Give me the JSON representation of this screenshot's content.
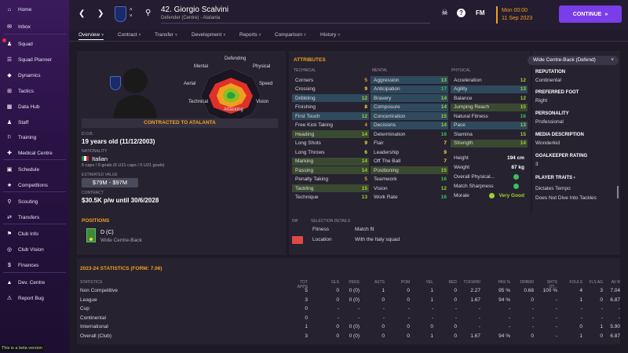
{
  "sidebar": {
    "items": [
      "Home",
      "Inbox",
      "Squad",
      "Squad Planner",
      "Dynamics",
      "Tactics",
      "Data Hub",
      "Staff",
      "Training",
      "Medical Centre",
      "Schedule",
      "Competitions",
      "Scouting",
      "Transfers",
      "Club Info",
      "Club Vision",
      "Finances",
      "Dev. Centre",
      "Report Bug"
    ],
    "beta": "This is a beta version"
  },
  "header": {
    "player_name": "42. Giorgio Scalvini",
    "player_sub": "Defender (Centre) - Atalanta",
    "date_line1": "Mon 00:00",
    "date_line2": "11 Sep 2023",
    "continue": "CONTINUE",
    "fm": "FM"
  },
  "tabs": [
    "Overview",
    "Contract",
    "Transfer",
    "Development",
    "Reports",
    "Comparison",
    "History"
  ],
  "profile": {
    "contract_banner": "CONTRACTED TO ATALANTA",
    "dob_label": "D.O.B.",
    "dob": "19 years old (11/12/2003)",
    "nationality_label": "NATIONALITY",
    "nationality": "Italian",
    "caps": "5 caps / 0 goals (6 U21 caps / 0 U21 goals)",
    "value_label": "ESTIMATED VALUE",
    "value": "$79M - $97M",
    "contract_label": "CONTRACT",
    "contract": "$30.5K p/w until 30/6/2028"
  },
  "radar": {
    "labels": [
      "Defending",
      "Physical",
      "Speed",
      "Vision",
      "Attacking",
      "Technical",
      "Aerial",
      "Mental"
    ]
  },
  "attributes": {
    "title": "ATTRIBUTES",
    "role": "Wide Centre-Back (Defend)",
    "tech_hdr": "TECHNICAL",
    "mental_hdr": "MENTAL",
    "phys_hdr": "PHYSICAL",
    "technical": [
      [
        "Corners",
        "5"
      ],
      [
        "Crossing",
        "9"
      ],
      [
        "Dribbling",
        "12"
      ],
      [
        "Finishing",
        "8"
      ],
      [
        "First Touch",
        "12"
      ],
      [
        "Free Kick Taking",
        "4"
      ],
      [
        "Heading",
        "14"
      ],
      [
        "Long Shots",
        "9"
      ],
      [
        "Long Throws",
        "6"
      ],
      [
        "Marking",
        "14"
      ],
      [
        "Passing",
        "14"
      ],
      [
        "Penalty Taking",
        "5"
      ],
      [
        "Tackling",
        "15"
      ],
      [
        "Technique",
        "13"
      ]
    ],
    "mental": [
      [
        "Aggression",
        "13"
      ],
      [
        "Anticipation",
        "17"
      ],
      [
        "Bravery",
        "14"
      ],
      [
        "Composure",
        "14"
      ],
      [
        "Concentration",
        "15"
      ],
      [
        "Decisions",
        "14"
      ],
      [
        "Determination",
        "16"
      ],
      [
        "Flair",
        "7"
      ],
      [
        "Leadership",
        "9"
      ],
      [
        "Off The Ball",
        "7"
      ],
      [
        "Positioning",
        "15"
      ],
      [
        "Teamwork",
        "16"
      ],
      [
        "Vision",
        "12"
      ],
      [
        "Work Rate",
        "16"
      ]
    ],
    "physical": [
      [
        "Acceleration",
        "12"
      ],
      [
        "Agility",
        "13"
      ],
      [
        "Balance",
        "12"
      ],
      [
        "Jumping Reach",
        "15"
      ],
      [
        "Natural Fitness",
        "16"
      ],
      [
        "Pace",
        "13"
      ],
      [
        "Stamina",
        "15"
      ],
      [
        "Strength",
        "14"
      ]
    ],
    "height_label": "Height",
    "height": "194 cm",
    "weight_label": "Weight",
    "weight": "87 kg",
    "overall_label": "Overall Physical...",
    "sharp_label": "Match Sharpness",
    "morale_label": "Morale",
    "morale": "Very Good"
  },
  "side": {
    "rep_label": "REPUTATION",
    "rep": "Continental",
    "foot_label": "PREFERRED FOOT",
    "foot": "Right",
    "pers_label": "PERSONALITY",
    "pers": "Professional",
    "media_label": "MEDIA DESCRIPTION",
    "media": "Wonderkid",
    "gk_label": "GOALKEEPER RATING",
    "gk": "3",
    "traits_label": "PLAYER TRAITS",
    "traits": [
      "Dictates Tempo",
      "Does Not Dive Into Tackles"
    ]
  },
  "positions": {
    "title": "POSITIONS",
    "pos": "D (C)",
    "role": "Wide Centre-Back"
  },
  "selection": {
    "inf": "INF",
    "title": "SELECTION DETAILS",
    "fitness_label": "Fitness",
    "fitness": "Match fit",
    "location_label": "Location",
    "location": "With the Italy squad"
  },
  "stats": {
    "title": "2023-24 STATISTICS (FORM: 7.06)",
    "headers": [
      "STATISTICS",
      "TOT APPS",
      "GLS",
      "PENS",
      "ASTS",
      "POM",
      "YEL",
      "RED",
      "TCKW/90",
      "PAS %",
      "DRB/90",
      "SHTS OT...",
      "FOULS",
      "FLS AG",
      "AV R"
    ],
    "rows": [
      [
        "Non Competitive",
        "5",
        "0",
        "0 (0)",
        "1",
        "0",
        "1",
        "0",
        "2.27",
        "95 %",
        "0.68",
        "100 %",
        "4",
        "3",
        "7.04"
      ],
      [
        "League",
        "3",
        "0",
        "0 (0)",
        "0",
        "0",
        "1",
        "0",
        "1.67",
        "94 %",
        "0",
        "-",
        "1",
        "0",
        "6.87"
      ],
      [
        "Cup",
        "0",
        "-",
        "-",
        "-",
        "-",
        "-",
        "-",
        "-",
        "-",
        "-",
        "-",
        "-",
        "-",
        "-"
      ],
      [
        "Continental",
        "0",
        "-",
        "-",
        "-",
        "-",
        "-",
        "-",
        "-",
        "-",
        "-",
        "-",
        "-",
        "-",
        "-"
      ],
      [
        "International",
        "1",
        "0",
        "0 (0)",
        "0",
        "0",
        "0",
        "0",
        "-",
        "-",
        "-",
        "-",
        "0",
        "1",
        "5.90"
      ],
      [
        "Overall (Club)",
        "3",
        "0",
        "0 (0)",
        "0",
        "0",
        "1",
        "0",
        "1.67",
        "94 %",
        "0",
        "-",
        "1",
        "0",
        "6.87"
      ]
    ]
  }
}
